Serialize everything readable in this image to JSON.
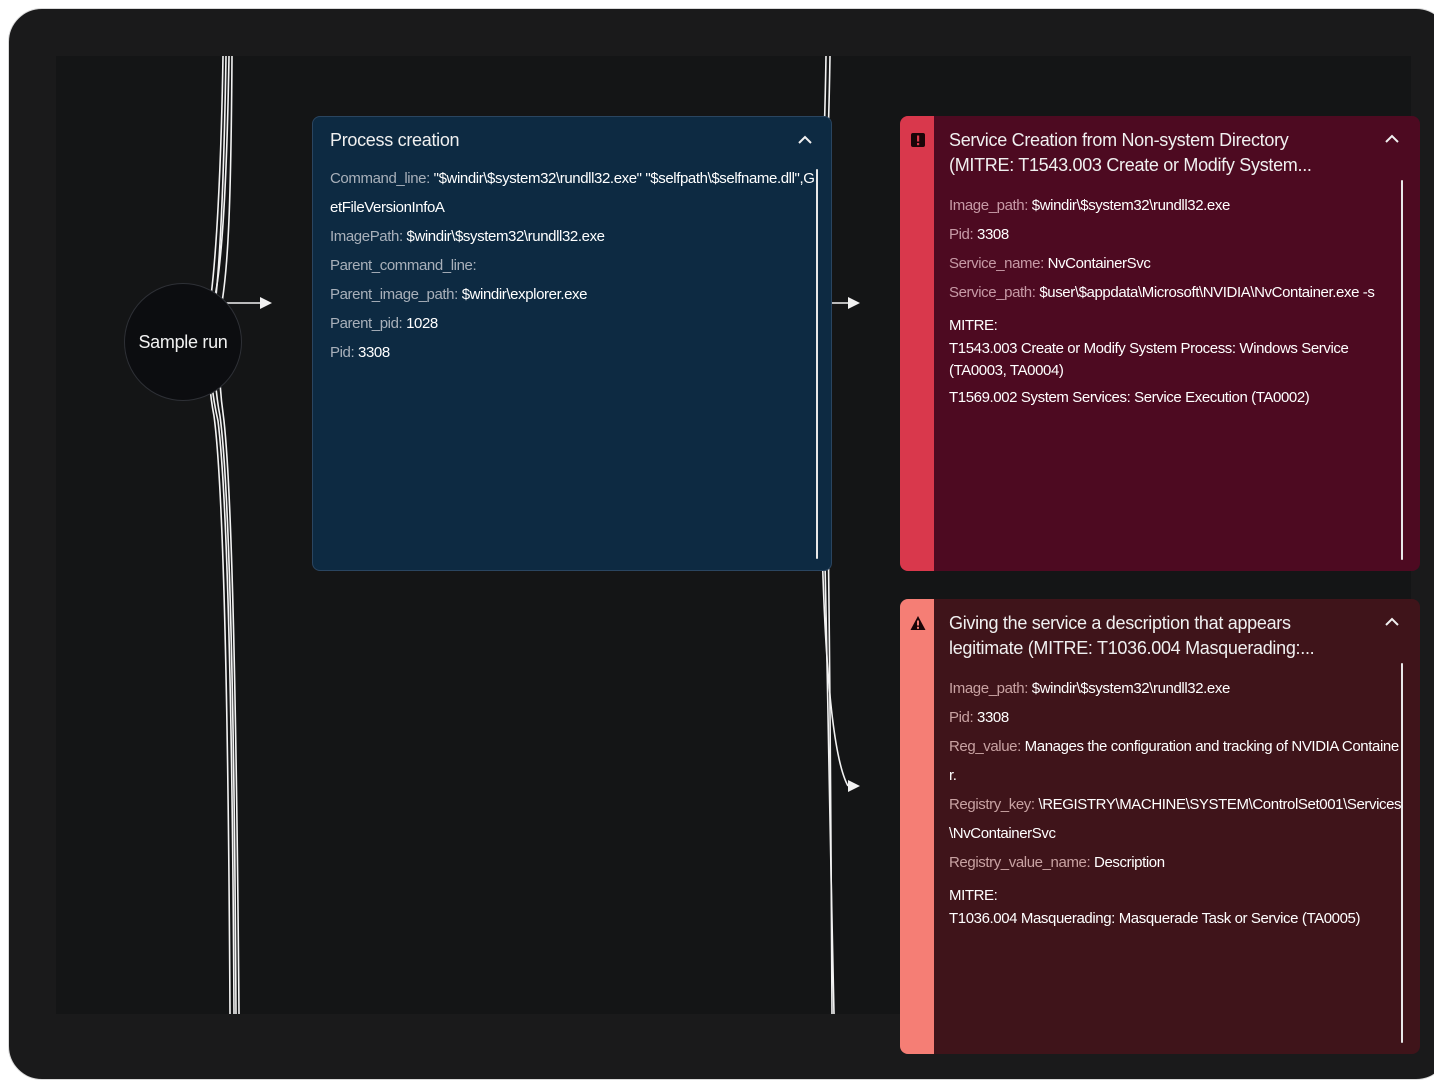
{
  "root": {
    "label": "Sample run"
  },
  "process_card": {
    "title": "Process creation",
    "fields": [
      {
        "key": "Command_line:",
        "value": "\"$windir\\$system32\\rundll32.exe\" \"$selfpath\\$selfname.dll\",GetFileVersionInfoA"
      },
      {
        "key": "ImagePath:",
        "value": "$windir\\$system32\\rundll32.exe"
      },
      {
        "key": "Parent_command_line:",
        "value": ""
      },
      {
        "key": "Parent_image_path:",
        "value": "$windir\\explorer.exe"
      },
      {
        "key": "Parent_pid:",
        "value": "1028"
      },
      {
        "key": "Pid:",
        "value": "3308"
      }
    ]
  },
  "alert_high": {
    "title_line1": "Service Creation from Non-system Directory",
    "title_line2": "(MITRE: T1543.003 Create or Modify System...",
    "severity_icon": "exclamation-square-icon",
    "stripe_color": "#d9384c",
    "fields": [
      {
        "key": "Image_path:",
        "value": "$windir\\$system32\\rundll32.exe"
      },
      {
        "key": "Pid:",
        "value": "3308"
      },
      {
        "key": "Service_name:",
        "value": "NvContainerSvc"
      },
      {
        "key": "Service_path:",
        "value": "$user\\$appdata\\Microsoft\\NVIDIA\\NvContainer.exe -s"
      }
    ],
    "mitre_label": "MITRE:",
    "mitre": [
      "T1543.003 Create or Modify System Process: Windows Service (TA0003, TA0004)",
      "T1569.002 System Services: Service Execution (TA0002)"
    ]
  },
  "alert_medium": {
    "title_line1": "Giving the service a description that appears",
    "title_line2": "legitimate (MITRE: T1036.004 Masquerading:...",
    "severity_icon": "warning-triangle-icon",
    "stripe_color": "#f57e75",
    "fields": [
      {
        "key": "Image_path:",
        "value": "$windir\\$system32\\rundll32.exe"
      },
      {
        "key": "Pid:",
        "value": "3308"
      },
      {
        "key": "Reg_value:",
        "value": "Manages the configuration and tracking of NVIDIA Container."
      },
      {
        "key": "Registry_key:",
        "value": "\\REGISTRY\\MACHINE\\SYSTEM\\ControlSet001\\Services\\NvContainerSvc"
      },
      {
        "key": "Registry_value_name:",
        "value": "Description"
      }
    ],
    "mitre_label": "MITRE:",
    "mitre": [
      "T1036.004 Masquerading: Masquerade Task or Service (TA0005)"
    ]
  }
}
